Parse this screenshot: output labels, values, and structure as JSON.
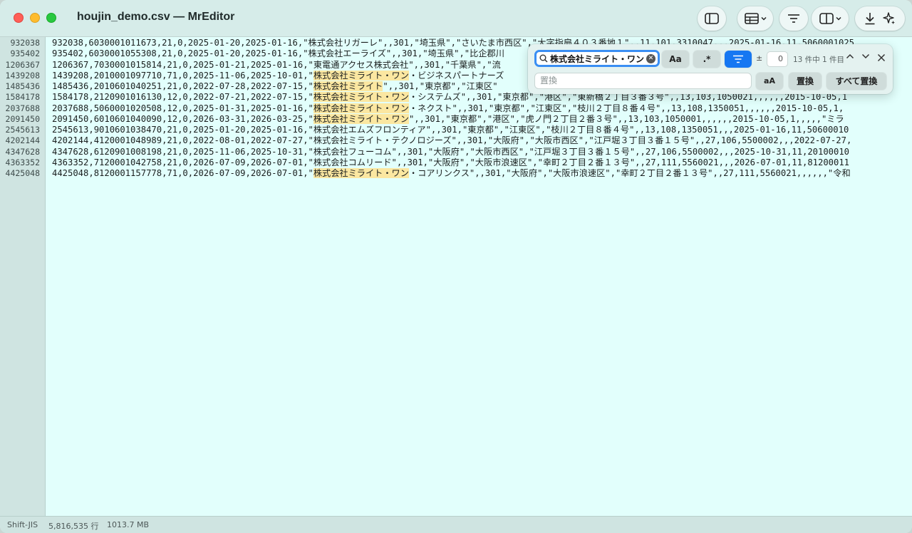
{
  "window": {
    "title": "houjin_demo.csv — MrEditor"
  },
  "toolbar": {
    "icons": [
      "sidebar-icon",
      "table-icon",
      "filter-icon",
      "split-view-icon",
      "download-icon",
      "sparkle-icon"
    ]
  },
  "editor": {
    "line_numbers": [
      "932038",
      "935402",
      "1206367",
      "1439208",
      "1485436",
      "1584178",
      "2037688",
      "2091450",
      "2545613",
      "4202144",
      "4347628",
      "4363352",
      "4425048"
    ],
    "rows": [
      {
        "pre": "932038,6030001011673,21,0,2025-01-20,2025-01-16,\"株式会社リガーレ\",,301,\"埼玉県\",\"さいたま市西区\",\"大字指扇４０３番地１\",,11,101,3310047,,,2025-01-16,11,5060001025",
        "hl": "",
        "post": ""
      },
      {
        "pre": "935402,6030001055308,21,0,2025-01-20,2025-01-16,\"株式会社エーライズ\",,301,\"埼玉県\",\"比企郡川",
        "hl": "",
        "post": ""
      },
      {
        "pre": "1206367,7030001015814,21,0,2025-01-21,2025-01-16,\"東電通アクセス株式会社\",,301,\"千葉県\",\"流",
        "hl": "",
        "post": ""
      },
      {
        "pre": "1439208,2010001097710,71,0,2025-11-06,2025-10-01,\"",
        "hl": "株式会社ミライト・ワン",
        "post": "・ビジネスパートナーズ"
      },
      {
        "pre": "1485436,2010601040251,21,0,2022-07-28,2022-07-15,\"",
        "hl": "株式会社ミライト",
        "post": "\",,301,\"東京都\",\"江東区\""
      },
      {
        "pre": "1584178,2120901016130,12,0,2022-07-21,2022-07-15,\"",
        "hl": "株式会社ミライト・ワン",
        "post": "・システムズ\",,301,\"東京都\",\"港区\",\"東新橋２丁目３番３号\",,13,103,1050021,,,,,,2015-10-05,1"
      },
      {
        "pre": "2037688,5060001020508,12,0,2025-01-31,2025-01-16,\"",
        "hl": "株式会社ミライト・ワン",
        "post": "・ネクスト\",,301,\"東京都\",\"江東区\",\"枝川２丁目８番４号\",,13,108,1350051,,,,,,2015-10-05,1,"
      },
      {
        "pre": "2091450,6010601040090,12,0,2026-03-31,2026-03-25,\"",
        "hl": "株式会社ミライト・ワン",
        "post": "\",,301,\"東京都\",\"港区\",\"虎ノ門２丁目２番３号\",,13,103,1050001,,,,,,2015-10-05,1,,,,,\"ミラ"
      },
      {
        "pre": "2545613,9010601038470,21,0,2025-01-20,2025-01-16,\"株式会社エムズフロンティア\",,301,\"東京都\",\"江東区\",\"枝川２丁目８番４号\",,13,108,1350051,,,2025-01-16,11,50600010",
        "hl": "",
        "post": ""
      },
      {
        "pre": "4202144,4120001048989,21,0,2022-08-01,2022-07-27,\"株式会社ミライト・テクノロジーズ\",,301,\"大阪府\",\"大阪市西区\",\"江戸堀３丁目３番１５号\",,27,106,5500002,,,2022-07-27,",
        "hl": "",
        "post": ""
      },
      {
        "pre": "4347628,6120901008198,21,0,2025-11-06,2025-10-31,\"株式会社フューコム\",,301,\"大阪府\",\"大阪市西区\",\"江戸堀３丁目３番１５号\",,27,106,5500002,,,2025-10-31,11,20100010",
        "hl": "",
        "post": ""
      },
      {
        "pre": "4363352,7120001042758,21,0,2026-07-09,2026-07-01,\"株式会社コムリード\",,301,\"大阪府\",\"大阪市浪速区\",\"幸町２丁目２番１３号\",,27,111,5560021,,,2026-07-01,11,81200011",
        "hl": "",
        "post": ""
      },
      {
        "pre": "4425048,8120001157778,71,0,2026-07-09,2026-07-01,\"",
        "hl": "株式会社ミライト・ワン",
        "post": "・コアリンクス\",,301,\"大阪府\",\"大阪市浪速区\",\"幸町２丁目２番１３号\",,27,111,5560021,,,,,,\"令和"
      }
    ]
  },
  "find": {
    "search_value": "株式会社ミライト・ワン",
    "match_case_label": "Aa",
    "regex_label": ".*",
    "plusminus": "±",
    "context_value": "0",
    "count_text": "13 件中 1 件目",
    "replace_placeholder": "置換",
    "preserve_case_label": "aA",
    "replace_label": "置換",
    "replace_all_label": "すべて置換"
  },
  "status": {
    "encoding": "Shift-JIS",
    "lines": "5,816,535 行",
    "size": "1013.7 MB"
  }
}
